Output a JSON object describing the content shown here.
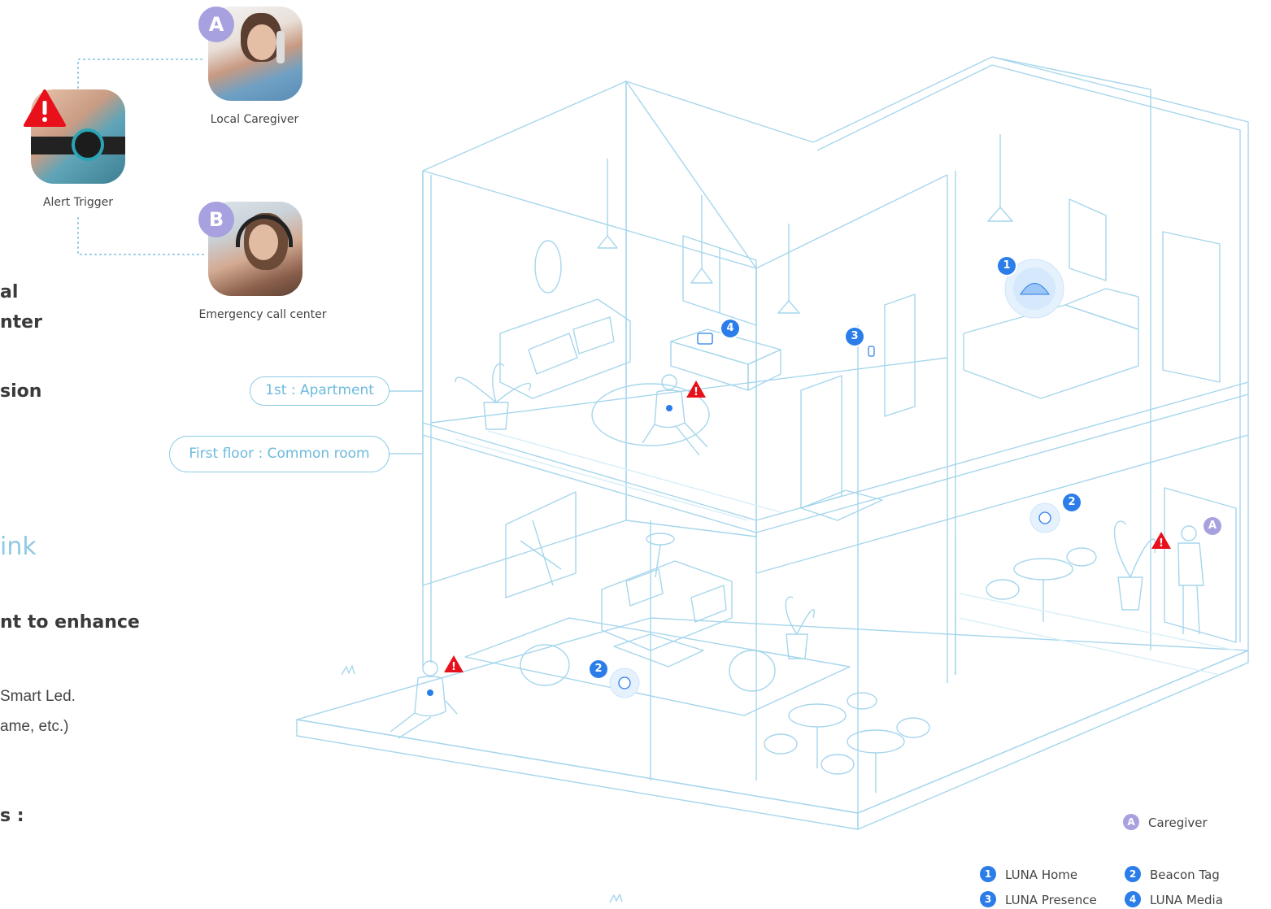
{
  "left_fragments": {
    "f1": "al",
    "f2": "nter",
    "f3": "sion",
    "f4": "ink",
    "f5": "nt to enhance",
    "f6": "Smart Led.",
    "f7": "ame, etc.)",
    "f8": "s :"
  },
  "alert": {
    "trigger_label": "Alert Trigger",
    "caregiver_badge": "A",
    "caregiver_label": "Local Caregiver",
    "callcenter_badge": "B",
    "callcenter_label": "Emergency call center"
  },
  "floors": {
    "apartment": "1st : Apartment",
    "common_room": "First floor : Common room"
  },
  "markers": {
    "m1": "1",
    "m2a": "2",
    "m2b": "2",
    "m3": "3",
    "m4": "4",
    "caregiver": "A"
  },
  "legend": {
    "caregiver_badge": "A",
    "caregiver": "Caregiver",
    "n1": "1",
    "luna_home": "LUNA Home",
    "n2": "2",
    "beacon_tag": "Beacon Tag",
    "n3": "3",
    "luna_presence": "LUNA Presence",
    "n4": "4",
    "luna_media": "LUNA Media"
  },
  "colors": {
    "line": "#9fd3ea",
    "accent_blue": "#2b7de9",
    "caregiver_purple": "#a7a1df",
    "alert_red": "#e8101a"
  }
}
